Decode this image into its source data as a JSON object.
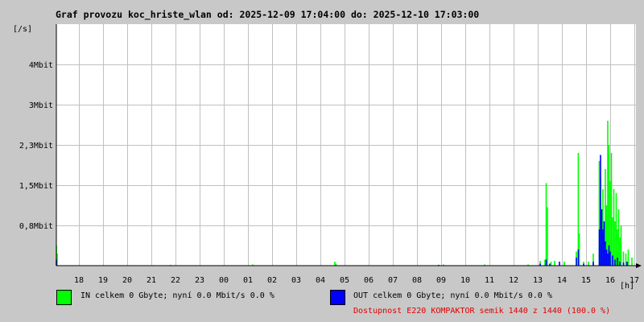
{
  "chart_data": {
    "type": "area",
    "title": "Graf provozu koc_hriste_wlan od: 2025-12-09 17:04:00 do: 2025-12-10 17:03:00",
    "ylabel": "[/s]",
    "xlabel": "[h]",
    "ylim": [
      0,
      6
    ],
    "xlim": [
      17.067,
      41.067
    ],
    "grid": true,
    "y_ticks": [
      {
        "value": 1,
        "label": "0,8Mbit"
      },
      {
        "value": 2,
        "label": "1,5Mbit"
      },
      {
        "value": 3,
        "label": "2,3Mbit"
      },
      {
        "value": 4,
        "label": "3Mbit"
      },
      {
        "value": 5,
        "label": "4Mbit"
      }
    ],
    "x_ticks": [
      {
        "value": 18,
        "label": "18"
      },
      {
        "value": 19,
        "label": "19"
      },
      {
        "value": 20,
        "label": "20"
      },
      {
        "value": 21,
        "label": "21"
      },
      {
        "value": 22,
        "label": "22"
      },
      {
        "value": 23,
        "label": "23"
      },
      {
        "value": 24,
        "label": "00"
      },
      {
        "value": 25,
        "label": "01"
      },
      {
        "value": 26,
        "label": "02"
      },
      {
        "value": 27,
        "label": "03"
      },
      {
        "value": 28,
        "label": "04"
      },
      {
        "value": 29,
        "label": "05"
      },
      {
        "value": 30,
        "label": "06"
      },
      {
        "value": 31,
        "label": "07"
      },
      {
        "value": 32,
        "label": "08"
      },
      {
        "value": 33,
        "label": "09"
      },
      {
        "value": 34,
        "label": "10"
      },
      {
        "value": 35,
        "label": "11"
      },
      {
        "value": 36,
        "label": "12"
      },
      {
        "value": 37,
        "label": "13"
      },
      {
        "value": 38,
        "label": "14"
      },
      {
        "value": 39,
        "label": "15"
      },
      {
        "value": 40,
        "label": "16"
      },
      {
        "value": 41,
        "label": "17"
      }
    ],
    "series": [
      {
        "name": "IN",
        "color": "#00ff00",
        "points": [
          [
            17.07,
            0.5
          ],
          [
            17.1,
            0.3
          ],
          [
            21.8,
            0.02
          ],
          [
            25.2,
            0.03
          ],
          [
            28.6,
            0.1
          ],
          [
            28.65,
            0.05
          ],
          [
            33.1,
            0.03
          ],
          [
            34.8,
            0.03
          ],
          [
            36.6,
            0.03
          ],
          [
            37.1,
            0.12
          ],
          [
            37.3,
            0.15
          ],
          [
            37.35,
            2.05
          ],
          [
            37.4,
            1.45
          ],
          [
            37.55,
            0.1
          ],
          [
            37.7,
            0.12
          ],
          [
            38.1,
            0.1
          ],
          [
            38.6,
            0.35
          ],
          [
            38.68,
            2.8
          ],
          [
            38.72,
            0.8
          ],
          [
            38.9,
            0.1
          ],
          [
            39.1,
            0.1
          ],
          [
            39.3,
            0.3
          ],
          [
            39.55,
            2.6
          ],
          [
            39.6,
            2.2
          ],
          [
            39.65,
            1.2
          ],
          [
            39.7,
            1.9
          ],
          [
            39.75,
            1.0
          ],
          [
            39.8,
            2.4
          ],
          [
            39.85,
            1.5
          ],
          [
            39.9,
            3.6
          ],
          [
            39.95,
            3.0
          ],
          [
            40.0,
            2.1
          ],
          [
            40.05,
            2.8
          ],
          [
            40.1,
            1.2
          ],
          [
            40.15,
            1.9
          ],
          [
            40.2,
            1.1
          ],
          [
            40.25,
            1.8
          ],
          [
            40.3,
            0.9
          ],
          [
            40.35,
            1.4
          ],
          [
            40.4,
            0.7
          ],
          [
            40.45,
            1.0
          ],
          [
            40.55,
            0.35
          ],
          [
            40.65,
            0.3
          ],
          [
            40.75,
            0.4
          ],
          [
            40.9,
            0.2
          ]
        ]
      },
      {
        "name": "OUT",
        "color": "#0000ff",
        "points": [
          [
            17.07,
            0.15
          ],
          [
            32.9,
            0.02
          ],
          [
            37.1,
            0.05
          ],
          [
            37.35,
            0.15
          ],
          [
            37.5,
            0.05
          ],
          [
            37.9,
            0.1
          ],
          [
            38.6,
            0.2
          ],
          [
            38.68,
            0.4
          ],
          [
            38.9,
            0.05
          ],
          [
            39.3,
            0.1
          ],
          [
            39.55,
            0.9
          ],
          [
            39.6,
            2.75
          ],
          [
            39.65,
            1.4
          ],
          [
            39.7,
            0.9
          ],
          [
            39.75,
            1.1
          ],
          [
            39.8,
            0.6
          ],
          [
            39.85,
            0.4
          ],
          [
            39.9,
            0.3
          ],
          [
            39.95,
            0.5
          ],
          [
            40.0,
            0.35
          ],
          [
            40.1,
            0.25
          ],
          [
            40.2,
            0.15
          ],
          [
            40.3,
            0.2
          ],
          [
            40.4,
            0.1
          ],
          [
            40.55,
            0.08
          ],
          [
            40.7,
            0.1
          ]
        ]
      }
    ]
  },
  "legend": {
    "in": {
      "text": "IN celkem 0 Gbyte; nyní   0.0 Mbit/s 0.0 %",
      "color": "#00ff00"
    },
    "out": {
      "text": "OUT celkem 0 Gbyte; nyní   0.0 Mbit/s 0.0 %",
      "color": "#0000ff"
    },
    "availability": "Dostupnost E220 KOMPAKTOR semik 1440 z 1440 (100.0 %)",
    "availability_color": "#e00000"
  }
}
